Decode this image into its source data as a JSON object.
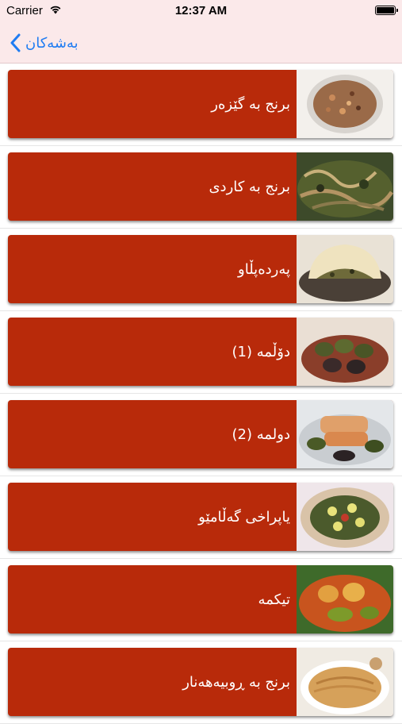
{
  "status_bar": {
    "carrier": "Carrier",
    "time": "12:37 AM"
  },
  "nav": {
    "back_label": "بەشەکان"
  },
  "recipes": [
    {
      "title": "برنج بە گێزەر"
    },
    {
      "title": "برنج بە کاردی"
    },
    {
      "title": "پەردەپڵاو"
    },
    {
      "title": "دۆڵمە (1)"
    },
    {
      "title": "دولمە (2)"
    },
    {
      "title": "یاپراخی گەڵامێو"
    },
    {
      "title": "تیکمە"
    },
    {
      "title": "برنج بە ڕوبیەهەنار"
    }
  ],
  "colors": {
    "card_bg": "#b82a0a",
    "nav_bg": "#fbe9ea",
    "accent": "#1f7cf2"
  }
}
